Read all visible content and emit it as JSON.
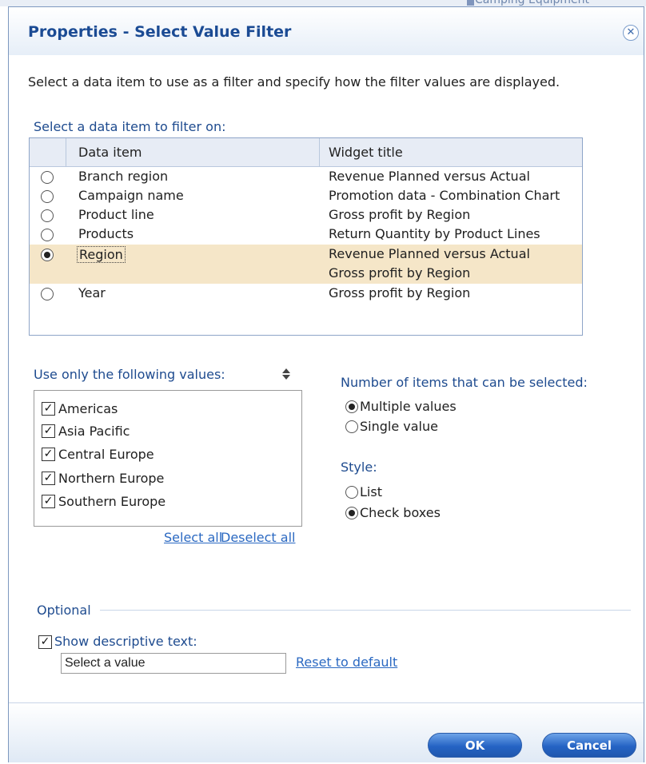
{
  "background": {
    "partial_text": "Camping Equipment"
  },
  "dialog": {
    "title": "Properties - Select Value Filter",
    "instruction": "Select a data item to use as a filter and specify how the filter values are displayed.",
    "grid_label": "Select a data item to filter on:",
    "columns": [
      "Data item",
      "Widget title"
    ],
    "rows": [
      {
        "item": "Branch region",
        "titles": [
          "Revenue Planned versus Actual"
        ],
        "selected": false
      },
      {
        "item": "Campaign name",
        "titles": [
          "Promotion data - Combination Chart"
        ],
        "selected": false
      },
      {
        "item": "Product line",
        "titles": [
          "Gross profit by Region"
        ],
        "selected": false
      },
      {
        "item": "Products",
        "titles": [
          "Return Quantity by Product Lines"
        ],
        "selected": false
      },
      {
        "item": "Region",
        "titles": [
          "Revenue Planned versus Actual",
          "Gross profit by Region"
        ],
        "selected": true
      },
      {
        "item": "Year",
        "titles": [
          "Gross profit by Region"
        ],
        "selected": false
      }
    ],
    "values_label": "Use only the following values:",
    "values": [
      {
        "label": "Americas",
        "checked": true
      },
      {
        "label": "Asia Pacific",
        "checked": true
      },
      {
        "label": "Central Europe",
        "checked": true
      },
      {
        "label": "Northern Europe",
        "checked": true
      },
      {
        "label": "Southern Europe",
        "checked": true
      }
    ],
    "select_all": "Select all",
    "deselect_all": "Deselect all",
    "count_label": "Number of items that can be selected:",
    "count_options": [
      {
        "label": "Multiple values",
        "selected": true
      },
      {
        "label": "Single value",
        "selected": false
      }
    ],
    "style_label": "Style:",
    "style_options": [
      {
        "label": "List",
        "selected": false
      },
      {
        "label": "Check boxes",
        "selected": true
      }
    ],
    "optional_label": "Optional",
    "show_text_label": "Show descriptive text:",
    "show_text_checked": true,
    "descriptive_text_value": "Select a value",
    "reset_link": "Reset to default",
    "ok_label": "OK",
    "cancel_label": "Cancel"
  }
}
